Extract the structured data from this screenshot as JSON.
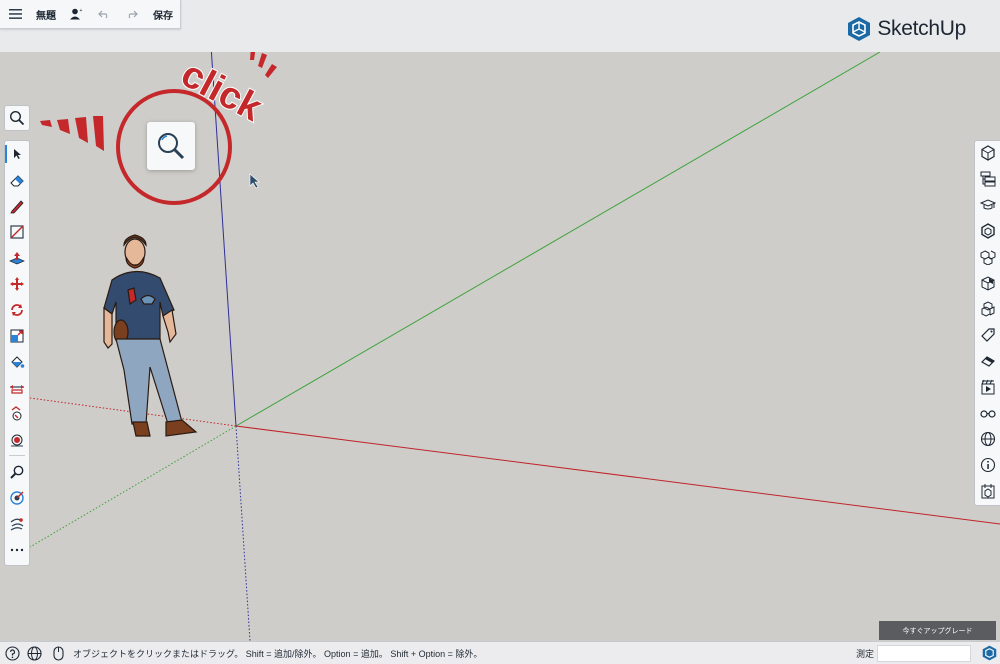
{
  "app": {
    "title": "無題",
    "save_label": "保存",
    "brand": "SketchUp"
  },
  "toolbar_left": {
    "search_icon": "search-icon",
    "tools": [
      {
        "name": "select-tool",
        "icon": "arrow-cursor-icon",
        "active": true
      },
      {
        "name": "eraser-tool",
        "icon": "eraser-icon"
      },
      {
        "name": "pencil-tool",
        "icon": "pencil-icon"
      },
      {
        "name": "rectangle-tool",
        "icon": "rectangle-icon"
      },
      {
        "name": "push-pull-tool",
        "icon": "push-pull-icon"
      },
      {
        "name": "move-tool",
        "icon": "move-icon"
      },
      {
        "name": "rotate-tool",
        "icon": "rotate-icon"
      },
      {
        "name": "scale-tool",
        "icon": "scale-icon"
      },
      {
        "name": "paint-bucket-tool",
        "icon": "paint-bucket-icon"
      },
      {
        "name": "offset-tool",
        "icon": "offset-icon"
      },
      {
        "name": "follow-me-tool",
        "icon": "follow-me-icon"
      },
      {
        "name": "orbit-tool",
        "icon": "orbit-icon"
      },
      {
        "name": "zoom-tool",
        "icon": "zoom-icon"
      },
      {
        "name": "tape-measure-tool",
        "icon": "tape-measure-icon"
      },
      {
        "name": "walk-tool",
        "icon": "walk-icon"
      },
      {
        "name": "more-tools",
        "icon": "more-icon"
      }
    ]
  },
  "toolbar_right": {
    "panels": [
      "entity-info-icon",
      "outliner-icon",
      "instructor-icon",
      "components-icon",
      "materials-icon",
      "styles-icon",
      "scenes-icon",
      "tags-icon",
      "soften-edges-icon",
      "animation-icon",
      "display-icon",
      "geo-location-icon",
      "info-icon",
      "trimble-connect-icon"
    ]
  },
  "annotation": {
    "text": "click",
    "color": "#c4282b"
  },
  "upgrade_label": "今すぐアップグレード",
  "statusbar": {
    "message": "オブジェクトをクリックまたはドラッグ。 Shift = 追加/除外。 Option = 追加。 Shift + Option = 除外。",
    "measurements_label": "測定",
    "measurements_value": ""
  },
  "colors": {
    "accent": "#2a83d8",
    "brand": "#1b6aa5",
    "axis_red": "#c0242a",
    "axis_green": "#3ba33b",
    "axis_blue": "#2e2f9a",
    "canvas": "#cfcdc9"
  }
}
